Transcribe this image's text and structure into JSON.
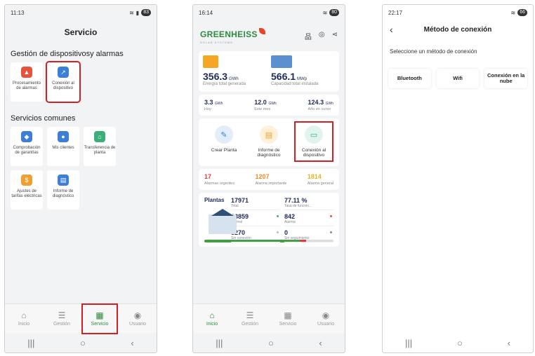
{
  "phone1": {
    "status": {
      "time": "11:13",
      "battery": "83"
    },
    "title": "Servicio",
    "section1": "Gestión de dispositivosy alarmas",
    "section1_tiles": [
      {
        "label": "Procesamiento de alarmas",
        "icon": "alarm-icon",
        "color": "#e5533d"
      },
      {
        "label": "Conexión al dispositivo",
        "icon": "device-connect-icon",
        "color": "#3b7fd6"
      }
    ],
    "section2": "Servicios comunes",
    "section2_tiles": [
      {
        "label": "Comprobación de garantías",
        "icon": "shield-icon",
        "color": "#3b7fd6"
      },
      {
        "label": "Mis clientes",
        "icon": "user-icon",
        "color": "#3b7fd6"
      },
      {
        "label": "Transferencia de planta",
        "icon": "transfer-icon",
        "color": "#3cae7a"
      },
      {
        "label": "Ajustes de tarifas eléctricas",
        "icon": "tariff-icon",
        "color": "#f0a030"
      },
      {
        "label": "Informe de diagnóstico",
        "icon": "report-icon",
        "color": "#3b7fd6"
      }
    ],
    "tabs": [
      "Inicio",
      "Gestión",
      "Servicio",
      "Usuario"
    ]
  },
  "phone2": {
    "status": {
      "time": "16:14",
      "battery": "80"
    },
    "brand": "GREENHEISS",
    "brand_sub": "SOLAR SYSTEMS",
    "kpi": [
      {
        "value": "356.3",
        "unit": "GWh",
        "label": "Energía total generada"
      },
      {
        "value": "566.1",
        "unit": "MWp",
        "label": "Capacidad total instalada"
      }
    ],
    "period": [
      {
        "value": "3.3",
        "unit": "GWh",
        "label": "Hoy"
      },
      {
        "value": "12.0",
        "unit": "GWh",
        "label": "Este mes"
      },
      {
        "value": "124.3",
        "unit": "GWh",
        "label": "Año en curso"
      }
    ],
    "actions": [
      "Crear Planta",
      "Informe de diagnóstico",
      "Conexión al dispositivo"
    ],
    "alarms": [
      {
        "value": "17",
        "label": "Alarmas urgentes",
        "color": "#e53935"
      },
      {
        "value": "1207",
        "label": "Alarma importante",
        "color": "#f08a24"
      },
      {
        "value": "1814",
        "label": "Alarma general",
        "color": "#e6b422"
      }
    ],
    "plants": {
      "title": "Plantas",
      "cells": [
        {
          "value": "17971",
          "label": "Total"
        },
        {
          "value": "77.11 %",
          "label": "Tasa de funcion..."
        },
        {
          "value": "13859",
          "label": "Normal",
          "dot": "#3cae7a"
        },
        {
          "value": "842",
          "label": "Alarma",
          "dot": "#e5533d"
        },
        {
          "value": "3270",
          "label": "Sin conexión",
          "dot": "#bbbbbb"
        },
        {
          "value": "0",
          "label": "Sin seguimiento",
          "dot": "#888888"
        }
      ]
    },
    "tabs": [
      "Inicio",
      "Gestión",
      "Servicio",
      "Usuario"
    ]
  },
  "phone3": {
    "status": {
      "time": "22:17",
      "battery": "66"
    },
    "title": "Método de conexión",
    "prompt": "Seleccione un método de conexión",
    "options": [
      "Bluetooth",
      "Wifi",
      "Conexión en la nube"
    ]
  }
}
